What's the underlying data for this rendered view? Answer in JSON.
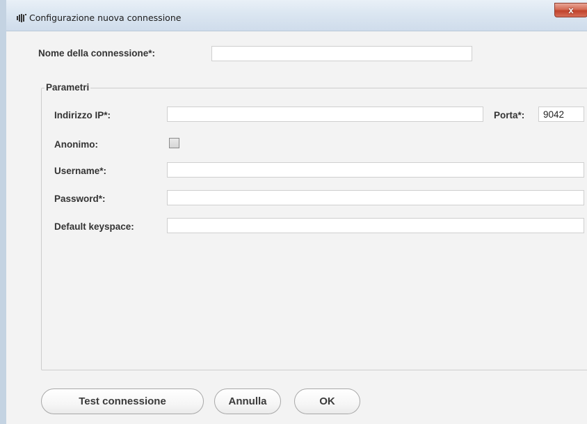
{
  "window": {
    "title": "Configurazione nuova connessione",
    "close_label": "x",
    "icon": "app-sound-icon"
  },
  "form": {
    "name_label": "Nome della connessione*:",
    "name_value": "",
    "group_title": "Parametri",
    "ip_label": "Indirizzo IP*:",
    "ip_value": "",
    "port_label": "Porta*:",
    "port_value": "9042",
    "anon_label": "Anonimo:",
    "anon_checked": false,
    "username_label": "Username*:",
    "username_value": "",
    "password_label": "Password*:",
    "password_value": "",
    "keyspace_label": "Default keyspace:",
    "keyspace_value": ""
  },
  "buttons": {
    "test": "Test connessione",
    "cancel": "Annulla",
    "ok": "OK"
  }
}
